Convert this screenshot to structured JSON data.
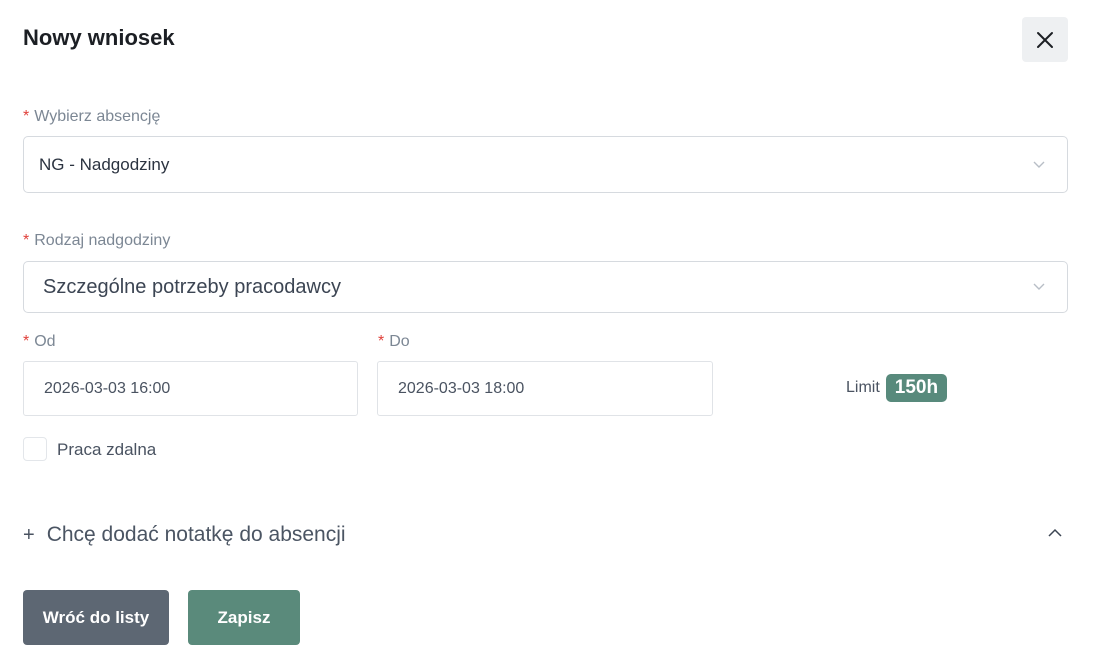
{
  "modal": {
    "title": "Nowy wniosek"
  },
  "form": {
    "absence": {
      "label": "Wybierz absencję",
      "required_mark": "*",
      "value": "NG - Nadgodziny"
    },
    "overtime_type": {
      "label": "Rodzaj nadgodziny",
      "required_mark": "*",
      "value": "Szczególne potrzeby pracodawcy"
    },
    "from": {
      "label": "Od",
      "required_mark": "*",
      "value": "2026-03-03 16:00"
    },
    "to": {
      "label": "Do",
      "required_mark": "*",
      "value": "2026-03-03 18:00"
    },
    "limit": {
      "label": "Limit",
      "value": "150h"
    },
    "remote_work": {
      "label": "Praca zdalna",
      "checked": false
    },
    "note_toggle": {
      "plus": "+",
      "label": "Chcę dodać notatkę do absencji"
    }
  },
  "buttons": {
    "back": "Wróć do listy",
    "save": "Zapisz"
  },
  "colors": {
    "accent": "#588a7c",
    "secondary_button": "#5d6773",
    "required": "#e0403a"
  }
}
